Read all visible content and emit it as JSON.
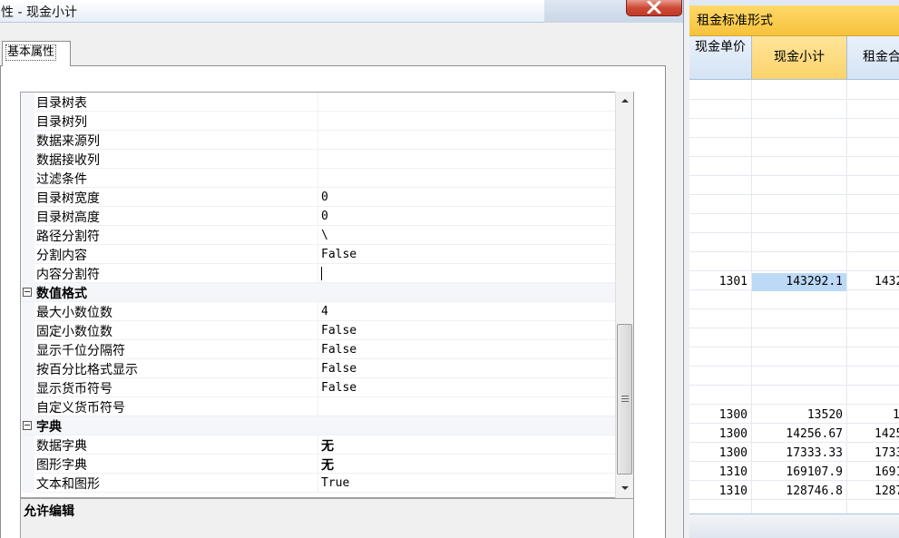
{
  "dialog": {
    "title": "属性 - 现金小计",
    "tab_label": "基本属性",
    "description_title": "允许编辑"
  },
  "properties": [
    {
      "name": "目录树表",
      "value": ""
    },
    {
      "name": "目录树列",
      "value": ""
    },
    {
      "name": "数据来源列",
      "value": ""
    },
    {
      "name": "数据接收列",
      "value": ""
    },
    {
      "name": "过滤条件",
      "value": ""
    },
    {
      "name": "目录树宽度",
      "value": "0"
    },
    {
      "name": "目录树高度",
      "value": "0"
    },
    {
      "name": "路径分割符",
      "value": "\\"
    },
    {
      "name": "分割内容",
      "value": "False"
    },
    {
      "name": "内容分割符",
      "value": ""
    },
    {
      "category": "数值格式"
    },
    {
      "name": "最大小数位数",
      "value": "4"
    },
    {
      "name": "固定小数位数",
      "value": "False"
    },
    {
      "name": "显示千位分隔符",
      "value": "False"
    },
    {
      "name": "按百分比格式显示",
      "value": "False"
    },
    {
      "name": "显示货币符号",
      "value": "False"
    },
    {
      "name": "自定义货币符号",
      "value": ""
    },
    {
      "category": "字典"
    },
    {
      "name": "数据字典",
      "value": "无"
    },
    {
      "name": "图形字典",
      "value": "无"
    },
    {
      "name": "文本和图形",
      "value": "True"
    }
  ],
  "sheet": {
    "caption": "租金标准形式",
    "headers": [
      "现金单价",
      "现金小计",
      "租金合"
    ],
    "rows": [
      {
        "c1": "1301",
        "c2": "143292.1",
        "c3": "1432"
      },
      {
        "c1": "1300",
        "c2": "13520",
        "c3": "1"
      },
      {
        "c1": "1300",
        "c2": "14256.67",
        "c3": "1425"
      },
      {
        "c1": "1300",
        "c2": "17333.33",
        "c3": "1733"
      },
      {
        "c1": "1310",
        "c2": "169107.9",
        "c3": "1691"
      },
      {
        "c1": "1310",
        "c2": "128746.8",
        "c3": "1287"
      }
    ]
  },
  "colors": {
    "caption_gold": "#f6c23a",
    "selected_cell": "#bcd9f6",
    "close_red": "#c23a28"
  },
  "icons": [
    "close-icon",
    "scroll-up-arrow-icon",
    "scroll-down-arrow-icon",
    "collapse-icon"
  ]
}
